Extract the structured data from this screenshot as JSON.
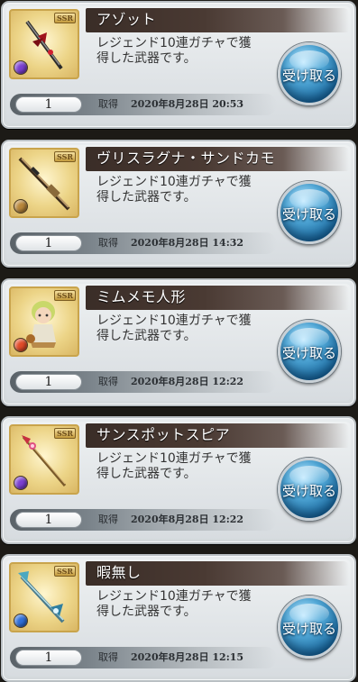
{
  "items": [
    {
      "name": "アゾット",
      "description_line1": "レジェンド10連ガチャで獲",
      "description_line2": "得した武器です。",
      "quantity": "1",
      "acquired_label": "取得",
      "acquired_date": "2020年8月28日 20:53",
      "receive_label": "受け取る",
      "rarity": "SSR",
      "element_color": "#7a3fd0",
      "weapon_icon": "dagger-icon"
    },
    {
      "name": "ヴリスラグナ・サンドカモ",
      "description_line1": "レジェンド10連ガチャで獲",
      "description_line2": "得した武器です。",
      "quantity": "1",
      "acquired_label": "取得",
      "acquired_date": "2020年8月28日 14:32",
      "receive_label": "受け取る",
      "rarity": "SSR",
      "element_color": "#b8863a",
      "weapon_icon": "rifle-icon"
    },
    {
      "name": "ミムメモ人形",
      "description_line1": "レジェンド10連ガチャで獲",
      "description_line2": "得した武器です。",
      "quantity": "1",
      "acquired_label": "取得",
      "acquired_date": "2020年8月28日 12:22",
      "receive_label": "受け取る",
      "rarity": "SSR",
      "element_color": "#e04a28",
      "weapon_icon": "doll-icon"
    },
    {
      "name": "サンスポットスピア",
      "description_line1": "レジェンド10連ガチャで獲",
      "description_line2": "得した武器です。",
      "quantity": "1",
      "acquired_label": "取得",
      "acquired_date": "2020年8月28日 12:22",
      "receive_label": "受け取る",
      "rarity": "SSR",
      "element_color": "#7a3fd0",
      "weapon_icon": "spear-icon"
    },
    {
      "name": "暇無し",
      "description_line1": "レジェンド10連ガチャで獲",
      "description_line2": "得した武器です。",
      "quantity": "1",
      "acquired_label": "取得",
      "acquired_date": "2020年8月28日 12:15",
      "receive_label": "受け取る",
      "rarity": "SSR",
      "element_color": "#2f6fd8",
      "weapon_icon": "scepter-icon"
    }
  ]
}
